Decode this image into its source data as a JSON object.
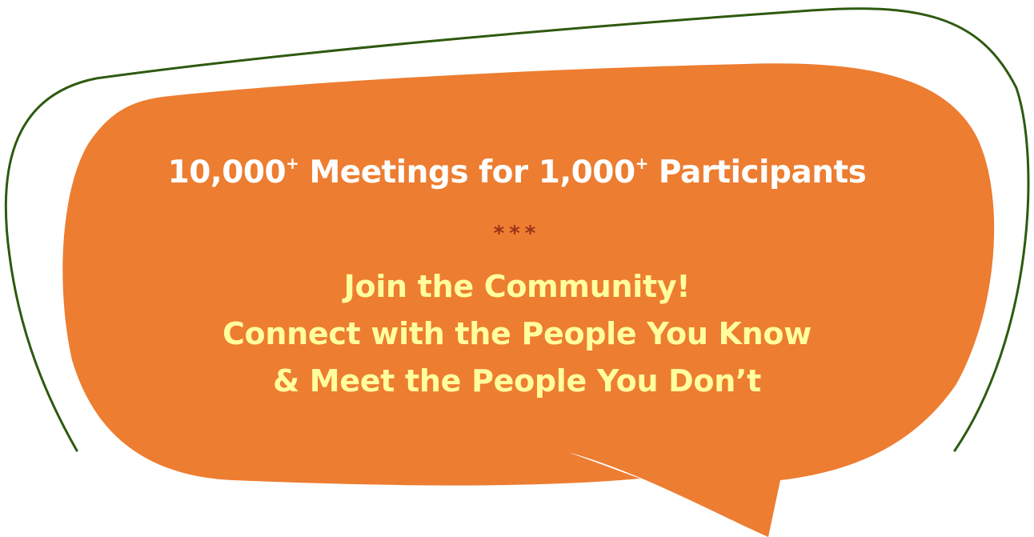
{
  "headline": {
    "part1": "10,000",
    "plus1": "+",
    "part2": " Meetings for 1,000",
    "plus2": "+",
    "part3": " Participants"
  },
  "separator": "***",
  "tagline": {
    "line1": "Join the Community!",
    "line2": "Connect with the People You Know",
    "line3": "& Meet the People You Don’t"
  },
  "colors": {
    "bubble_fill": "#ed7d31",
    "outline_stroke": "#2e5a10",
    "headline_text": "#ffffff",
    "separator_text": "#9b3518",
    "tagline_text": "#ffff9e"
  }
}
